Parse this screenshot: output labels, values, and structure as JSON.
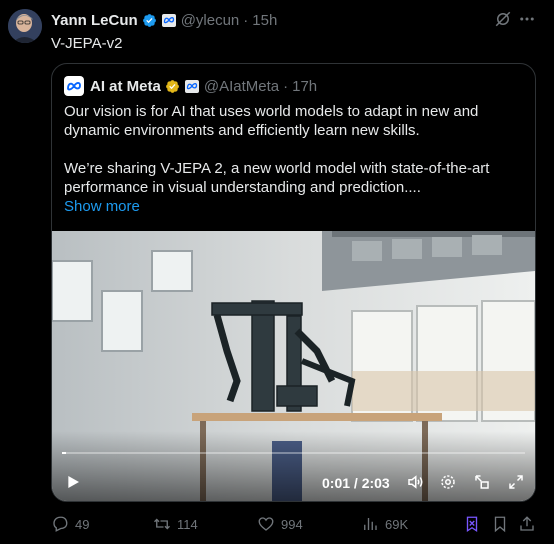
{
  "tweet": {
    "author_name": "Yann LeCun",
    "handle": "@ylecun",
    "separator": "·",
    "time": "15h",
    "text": "V-JEPA-v2"
  },
  "quote": {
    "author_name": "AI at Meta",
    "handle": "@AIatMeta",
    "separator": "·",
    "time": "17h",
    "paragraph1": "Our vision is for AI that uses world models to adapt in new and dynamic environments and efficiently learn new skills.",
    "paragraph2": "We’re sharing V-JEPA 2, a new world model with state-of-the-art performance in visual understanding and prediction....",
    "show_more": "Show more"
  },
  "video": {
    "time_display": "0:01 / 2:03",
    "progress": 0.008
  },
  "actions": {
    "replies": "49",
    "reposts": "114",
    "likes": "994",
    "views": "69K"
  },
  "colors": {
    "accent": "#1d9bf0",
    "muted": "#71767b",
    "text": "#e7e9ea",
    "border": "#2f3336",
    "gold": "#e2b719"
  },
  "icons": [
    "verified-badge-icon",
    "affiliate-meta-icon",
    "grok-icon",
    "more-icon",
    "meta-logo-icon",
    "gold-verified-icon",
    "play-icon",
    "volume-icon",
    "settings-icon",
    "pip-icon",
    "fullscreen-icon",
    "reply-icon",
    "repost-icon",
    "like-icon",
    "views-icon",
    "grok-explain-icon",
    "bookmark-icon",
    "share-icon"
  ]
}
